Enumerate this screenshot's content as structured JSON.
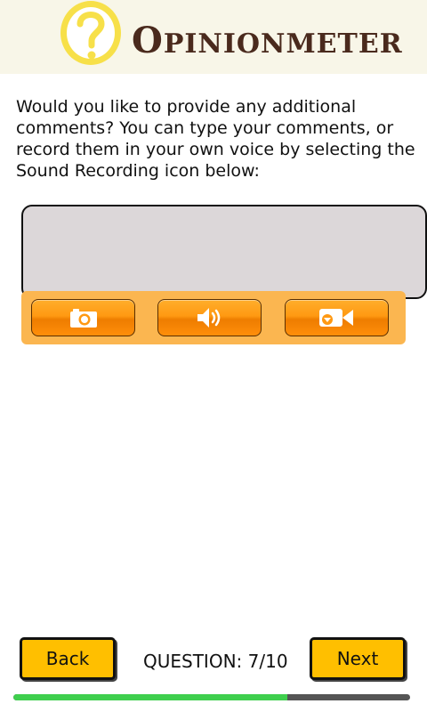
{
  "header": {
    "brand_initial": "O",
    "brand_rest": "PINIONMETER",
    "logo_icon": "question-mark-circle-icon"
  },
  "prompt": {
    "text": "Would you like to provide any additional comments? You can type your comments, or record them in your own voice by selecting the Sound Recording icon below:"
  },
  "comment": {
    "value": "",
    "placeholder": ""
  },
  "media": {
    "buttons": [
      {
        "icon": "camera-icon"
      },
      {
        "icon": "speaker-icon"
      },
      {
        "icon": "video-camera-icon"
      }
    ]
  },
  "navigation": {
    "back_label": "Back",
    "next_label": "Next",
    "question_label": "QUESTION: 7/10",
    "question_current": 7,
    "question_total": 10
  },
  "progress": {
    "value": 0.69
  },
  "colors": {
    "header_bg": "#f8f6e8",
    "brand_text": "#4a2a1d",
    "logo_yellow": "#f7e049",
    "media_bar": "#fbb650",
    "media_button": "#ff9912",
    "nav_button": "#ffbf00",
    "progress_fill": "#3fcf4e",
    "progress_track": "#555555"
  }
}
